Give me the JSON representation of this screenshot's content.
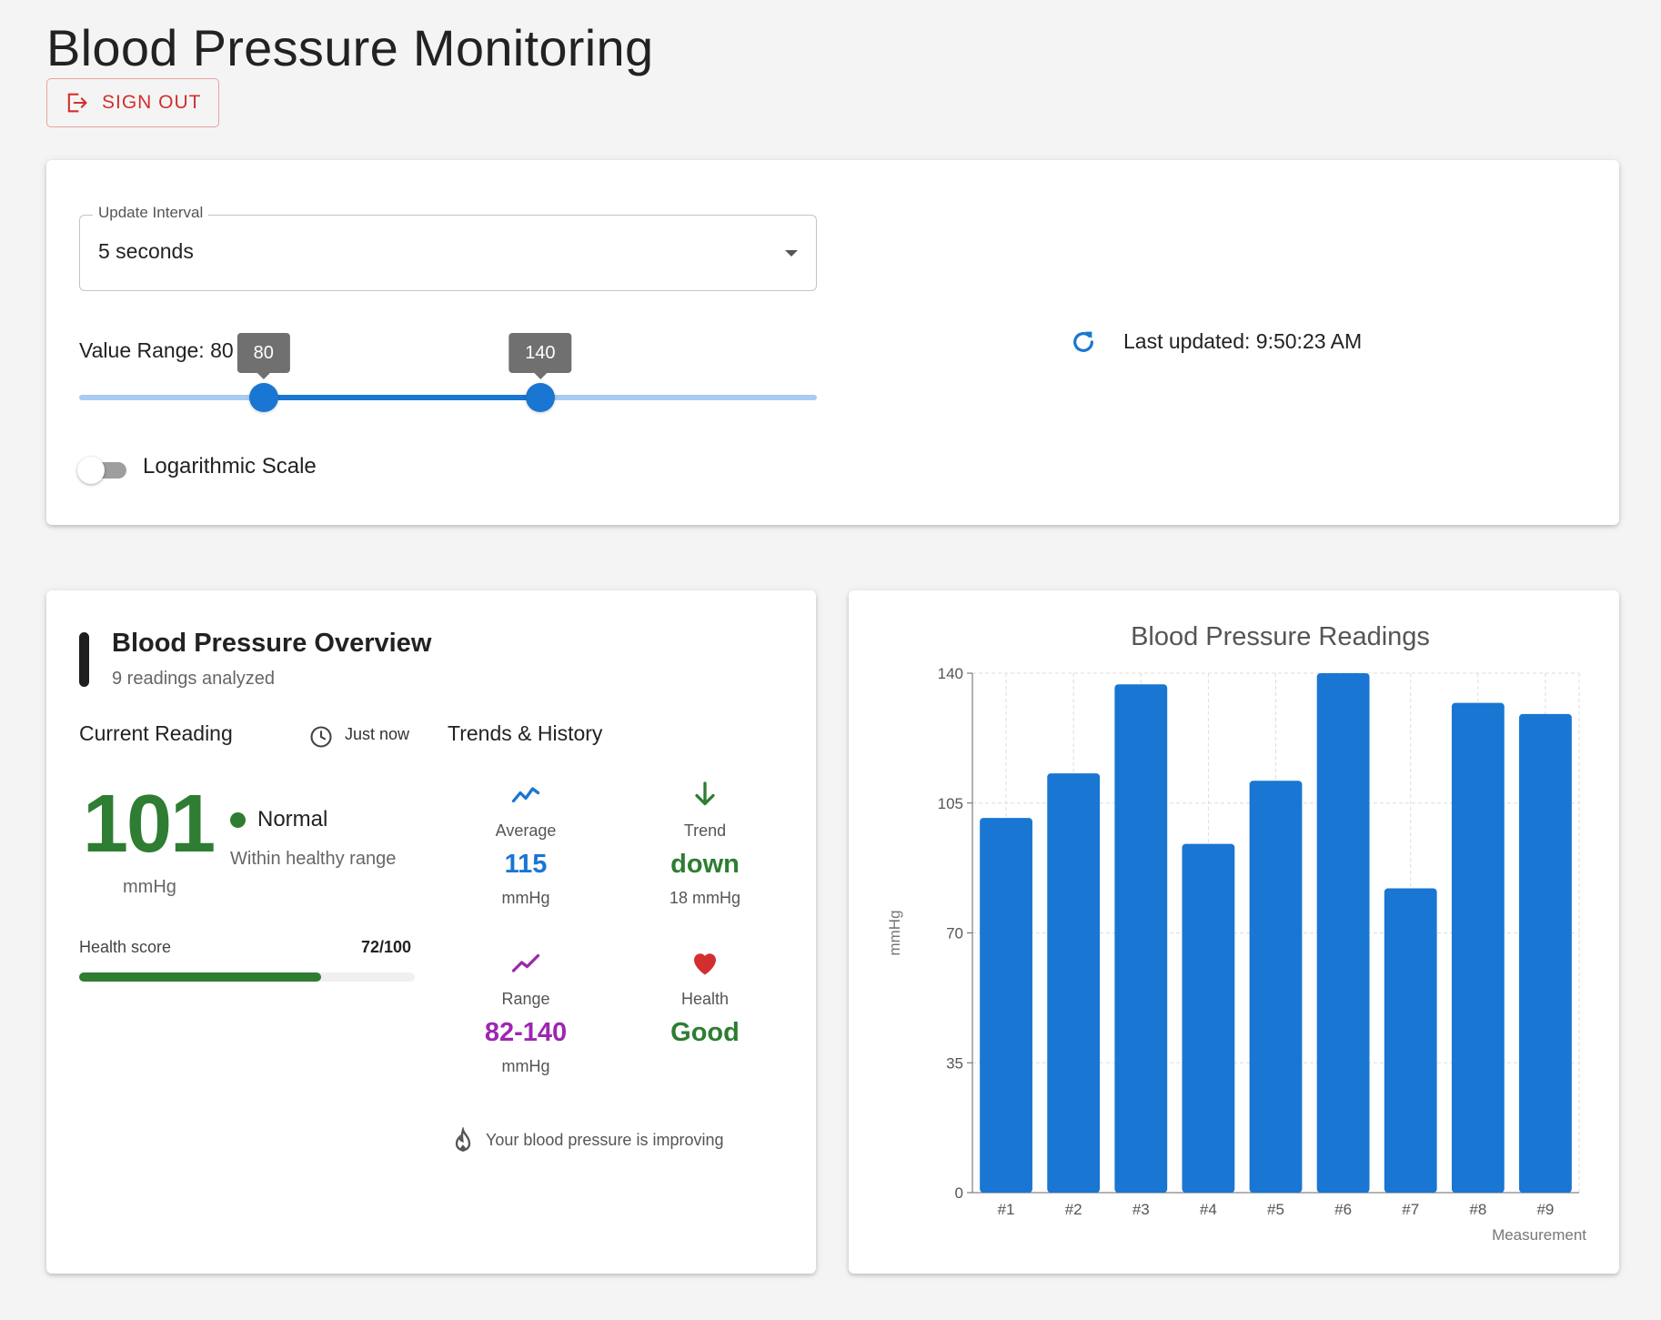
{
  "page": {
    "title": "Blood Pressure Monitoring",
    "signout_label": "SIGN OUT"
  },
  "controls": {
    "interval_label": "Update Interval",
    "interval_value": "5 seconds",
    "range_label": "Value Range: 80 - 140",
    "range_low": 80,
    "range_high": 140,
    "range_low_text": "80",
    "range_high_text": "140",
    "range_min": 40,
    "range_max": 200,
    "log_scale_label": "Logarithmic Scale",
    "log_scale_on": false,
    "last_updated": "Last updated: 9:50:23 AM"
  },
  "overview": {
    "title": "Blood Pressure Overview",
    "subtitle": "9 readings analyzed",
    "current_heading": "Current Reading",
    "time_label": "Just now",
    "reading": "101",
    "reading_unit": "mmHg",
    "status": "Normal",
    "status_desc": "Within healthy range",
    "health_score_label": "Health score",
    "health_score_text": "72/100",
    "health_score": 72,
    "trends_heading": "Trends & History",
    "stats": [
      {
        "label": "Average",
        "value": "115",
        "sub": "mmHg",
        "color": "#1976d2",
        "icon": "trend-line-icon"
      },
      {
        "label": "Trend",
        "value": "down",
        "sub": "18 mmHg",
        "color": "#2e7d32",
        "icon": "arrow-down-icon"
      },
      {
        "label": "Range",
        "value": "82-140",
        "sub": "mmHg",
        "color": "#9c27b0",
        "icon": "trend-line-icon"
      },
      {
        "label": "Health",
        "value": "Good",
        "sub": "",
        "color": "#2e7d32",
        "icon": "heart-icon"
      }
    ],
    "message": "Your blood pressure is improving"
  },
  "chart_data": {
    "type": "bar",
    "title": "Blood Pressure Readings",
    "xlabel": "Measurement",
    "ylabel": "mmHg",
    "categories": [
      "#1",
      "#2",
      "#3",
      "#4",
      "#5",
      "#6",
      "#7",
      "#8",
      "#9"
    ],
    "values": [
      101,
      113,
      137,
      94,
      111,
      140,
      82,
      132,
      129
    ],
    "ylim": [
      0,
      140
    ],
    "yticks": [
      0,
      35,
      70,
      105,
      140
    ],
    "grid": true,
    "bar_color": "#1976d2"
  }
}
